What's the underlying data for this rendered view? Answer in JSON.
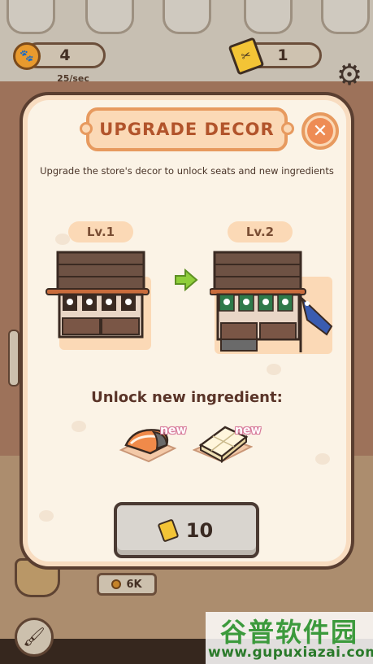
{
  "hud": {
    "coins": "4",
    "coin_rate": "25/sec",
    "tickets": "1",
    "coin_icon": "paw-coin-icon",
    "ticket_icon": "ticket-icon",
    "settings_icon": "gear-icon"
  },
  "background": {
    "counter_value": "6K",
    "roller_icon": "paint-roller-icon"
  },
  "modal": {
    "title": "UPGRADE DECOR",
    "subtitle": "Upgrade the store's decor to unlock seats and new ingredients",
    "current_level": "Lv.1",
    "next_level": "Lv.2",
    "unlock_title": "Unlock new ingredient:",
    "ingredients": [
      {
        "name": "salmon",
        "tag": "new"
      },
      {
        "name": "tofu",
        "tag": "new"
      }
    ],
    "cost": "10",
    "close_icon": "close-icon"
  },
  "watermark": {
    "title": "谷普软件园",
    "url": "www.gupuxiazai.com"
  },
  "colors": {
    "accent_orange": "#e79a5f",
    "title_text": "#b2542b",
    "modal_bg": "#fbf3e6",
    "outline": "#5a3e30",
    "button_disabled": "#d9d5cf"
  }
}
